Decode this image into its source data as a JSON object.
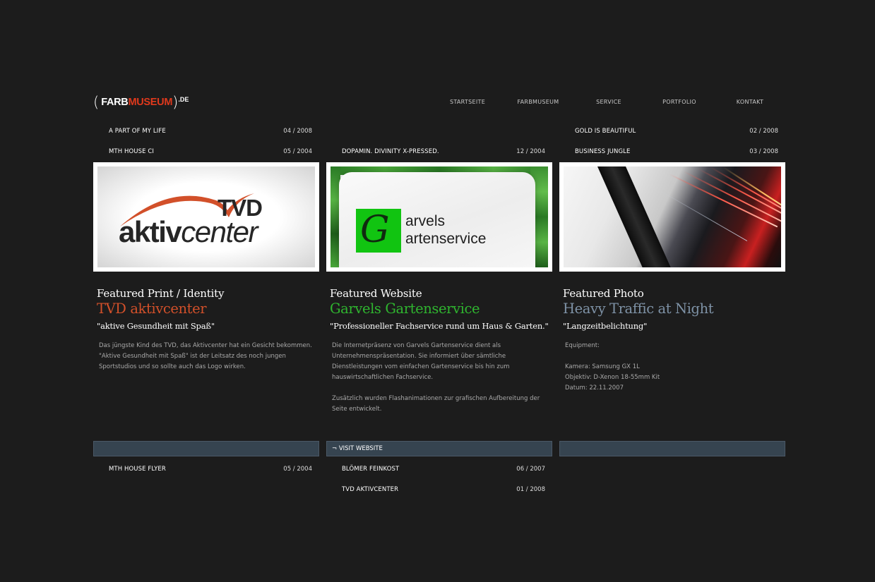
{
  "logo": {
    "farb": "FARB",
    "museum": "MUSEUM",
    "de": ".DE",
    "paren_open": "(",
    "paren_close": ")"
  },
  "nav": [
    "STARTSEITE",
    "FARBMUSEUM",
    "SERVICE",
    "PORTFOLIO",
    "KONTAKT"
  ],
  "top_links": {
    "col1": [
      {
        "title": "A PART OF MY LIFE",
        "date": "04 / 2008"
      },
      {
        "title": "MTH HOUSE CI",
        "date": "05 / 2004"
      }
    ],
    "col2": [
      {
        "title": "DOPAMIN. DIVINITY X-PRESSED.",
        "date": "12 / 2004"
      }
    ],
    "col3": [
      {
        "title": "GOLD IS BEAUTIFUL",
        "date": "02 / 2008"
      },
      {
        "title": "BUSINESS JUNGLE",
        "date": "03 / 2008"
      }
    ]
  },
  "images": {
    "tvd": {
      "top": "TVD",
      "bold": "aktiv",
      "italic": "center"
    },
    "garvels": {
      "letter": "G",
      "line1": "arvels",
      "line2": "artenservice"
    }
  },
  "featured": [
    {
      "label": "Featured Print / Identity",
      "name": "TVD aktivcenter",
      "color": "#d2502a",
      "quote": "\"aktive Gesundheit mit Spaß\"",
      "desc": [
        "Das jüngste Kind des TVD, das Aktivcenter hat ein Gesicht bekommen.",
        "\"Aktive Gesundheit mit Spaß\" ist der Leitsatz des noch jungen",
        "Sportstudios und so sollte auch das Logo wirken."
      ]
    },
    {
      "label": "Featured Website",
      "name": "Garvels Gartenservice",
      "color": "#2fb52f",
      "quote": "\"Professioneller Fachservice rund um Haus & Garten.\"",
      "desc": [
        "Die Internetpräsenz von Garvels Gartenservice dient als",
        "Unternehmenspräsentation. Sie informiert über sämtliche",
        "Dienstleistungen vom einfachen Gartenservice bis hin zum",
        "hauswirtschaftlichen Fachservice.",
        "",
        "Zusätzlich wurden Flashanimationen zur grafischen Aufbereitung der",
        "Seite entwickelt."
      ]
    },
    {
      "label": "Featured Photo",
      "name": "Heavy Traffic at Night",
      "color": "#7e92a6",
      "quote": "\"Langzeitbelichtung\"",
      "desc": [
        "Equipment:",
        "",
        "Kamera: Samsung GX 1L",
        "Objektiv: D-Xenon 18-55mm Kit",
        "Datum: 22.11.2007"
      ]
    }
  ],
  "bars": [
    "",
    "¬ VISIT WEBSITE",
    ""
  ],
  "bottom_links": {
    "col1": [
      {
        "title": "MTH HOUSE FLYER",
        "date": "05 / 2004"
      }
    ],
    "col2": [
      {
        "title": "BLÖMER FEINKOST",
        "date": "06 / 2007"
      },
      {
        "title": "TVD AKTIVCENTER",
        "date": "01 / 2008"
      }
    ]
  }
}
